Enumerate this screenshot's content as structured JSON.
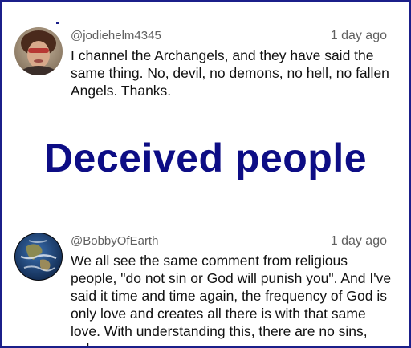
{
  "comments": [
    {
      "handle": "@jodiehelm4345",
      "time": "1 day ago",
      "text": "I channel the Archangels, and they have said the same thing.  No, devil, no demons, no hell, no fallen Angels.  Thanks."
    },
    {
      "handle": "@BobbyOfEarth",
      "time": "1 day ago",
      "text": "We all see the same comment from religious people, \"do not sin or God will punish you\". And I've said it time and time again, the frequency of God is only love and creates all there is with that same love. With understanding this, there are no sins, only"
    }
  ],
  "overlay": {
    "caption": "Deceived people",
    "color": "#0d0d85"
  },
  "colors": {
    "frame_border": "#1b1f8a",
    "meta_text": "#606060",
    "body_text": "#111111"
  }
}
